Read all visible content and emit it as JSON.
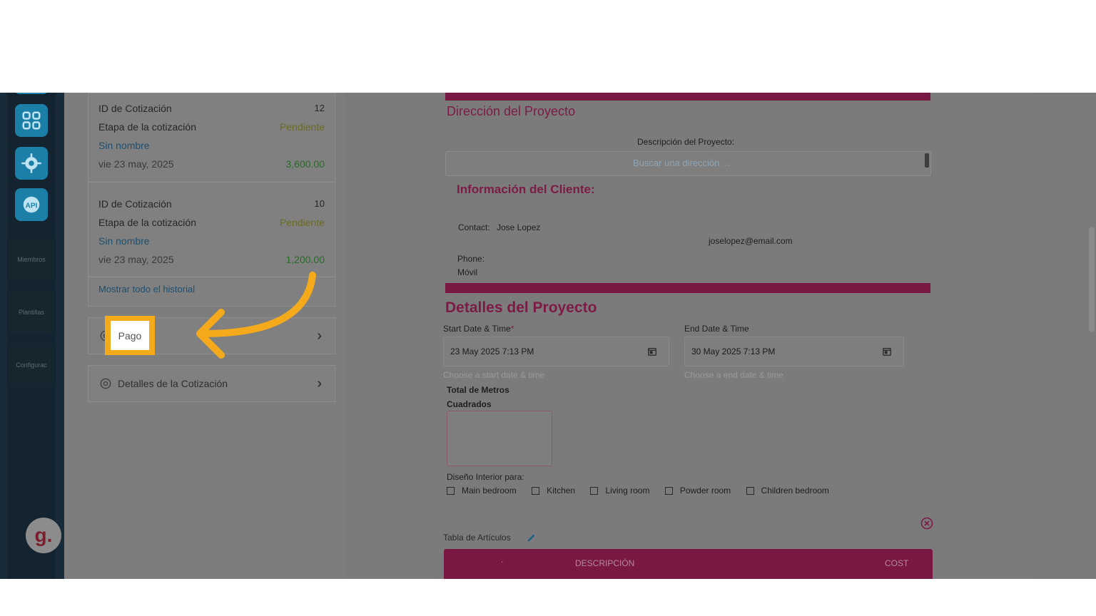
{
  "sidebar": {
    "items": [
      {
        "label": "Miembros"
      },
      {
        "label": "Plantillas"
      },
      {
        "label": "Configurac"
      }
    ],
    "avatar_letter": "g."
  },
  "history": {
    "entries": [
      {
        "id_label": "ID de Cotización",
        "id_value": "12",
        "stage_label": "Etapa de la cotización",
        "stage_value": "Pendiente",
        "name": "Sin nombre",
        "date": "vie 23 may, 2025",
        "amount": "3,600.00"
      },
      {
        "id_label": "ID de Cotización",
        "id_value": "10",
        "stage_label": "Etapa de la cotización",
        "stage_value": "Pendiente",
        "name": "Sin nombre",
        "date": "vie 23 may, 2025",
        "amount": "1,200.00"
      }
    ],
    "show_all_link": "Mostrar todo el historial"
  },
  "nav_cards": [
    {
      "label": "Pago"
    },
    {
      "label": "Detalles de la Cotización"
    }
  ],
  "document": {
    "address_title": "Dirección del Proyecto",
    "project_description_label": "Descripción del Proyecto:",
    "address_placeholder": "Buscar una dirección ...",
    "client_title": "Información del Cliente:",
    "contact_label": "Contact:",
    "contact_value": "Jose Lopez",
    "email": "joselopez@email.com",
    "phone_label": "Phone:",
    "phone_value": "Móvil",
    "details_title": "Detalles del Proyecto",
    "start_label": "Start Date & Time",
    "start_required": "*",
    "start_value": "23 May 2025 7:13 PM",
    "start_help": "Choose a start date & time",
    "end_label": "End Date & Time",
    "end_value": "30 May 2025 7:13 PM",
    "end_help": "Choose a end date & time",
    "sqm_label_1": "Total de Metros",
    "sqm_label_2": "Cuadrados",
    "interior_label": "Diseño Interior para:",
    "rooms": [
      "Main bedroom",
      "Kitchen",
      "Living room",
      "Powder room",
      "Children bedroom"
    ],
    "items_table_label": "Tabla de Artículos",
    "table_headers": {
      "dot": ".",
      "description": "DESCRIPCIÓN",
      "cost": "COST"
    }
  },
  "colors": {
    "brand_magenta": "#7a1844",
    "highlight_orange": "#f5aa1c",
    "app_icon_blue": "#1b7fa8",
    "rail_dark": "#172b3a"
  },
  "icons": [
    "apps-grid-icon",
    "settings-gear-icon",
    "api-icon",
    "gear-icon",
    "chevron-right-icon",
    "calendar-icon",
    "pencil-icon",
    "close-circle-icon",
    "curved-arrow-annotation"
  ]
}
